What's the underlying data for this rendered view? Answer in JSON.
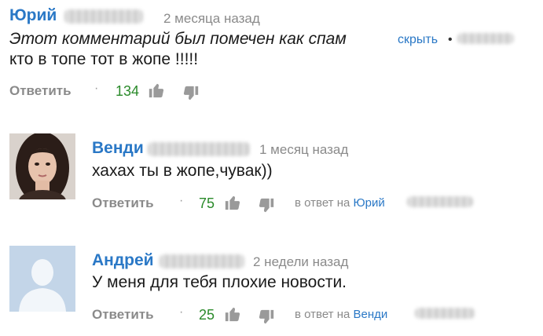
{
  "comments": [
    {
      "author": "Юрий",
      "time": "2 месяца назад",
      "spam_text": "Этот комментарий был помечен как спам",
      "hide_link": "скрыть",
      "dot": "•",
      "text": "кто в топе тот в жопе !!!!!",
      "reply_label": "Ответить",
      "separator": "·",
      "likes": "134"
    },
    {
      "author": "Венди",
      "time": "1 месяц назад",
      "text": "хахах ты в жопе,чувак))",
      "reply_label": "Ответить",
      "separator": "·",
      "likes": "75",
      "in_reply_prefix": "в ответ на",
      "in_reply_to": "Юрий",
      "avatar": "photo-avatar"
    },
    {
      "author": "Андрей",
      "time": "2 недели назад",
      "text": "У меня для тебя плохие новости.",
      "reply_label": "Ответить",
      "separator": "·",
      "likes": "25",
      "in_reply_prefix": "в ответ на",
      "in_reply_to": "Венди",
      "avatar": "default-silhouette-avatar"
    }
  ],
  "colors": {
    "link": "#2a78c6",
    "likes": "#2a8a2a",
    "muted": "#8a8a8a",
    "avatar_default_bg": "#b8cde3"
  }
}
